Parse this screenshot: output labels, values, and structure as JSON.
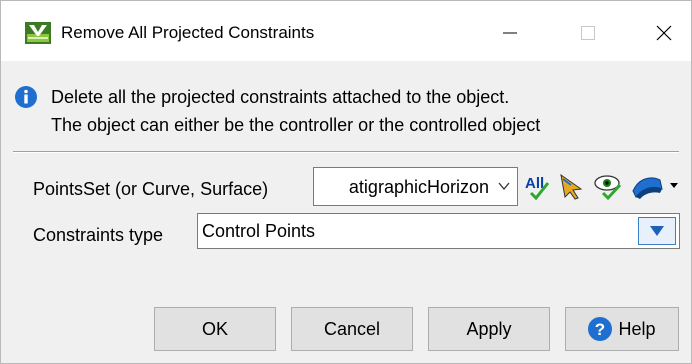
{
  "window": {
    "title": "Remove All Projected Constraints",
    "app_icon": "skua-gocad-app-icon",
    "controls": {
      "minimize": "minimize-icon",
      "maximize": "maximize-icon",
      "close": "close-icon"
    }
  },
  "info": {
    "icon": "info-icon",
    "line1": "Delete all the projected constraints attached to the object.",
    "line2": "The object can either be the controller or the controlled object"
  },
  "points_set": {
    "label": "PointsSet (or Curve, Surface)",
    "value": "atigraphicHorizon",
    "tools": {
      "all_label": "All",
      "pick_icon": "pick-cursor-icon",
      "eye_icon": "visible-eye-icon",
      "object_icon": "surface-object-icon"
    }
  },
  "constraints_type": {
    "label": "Constraints type",
    "value": "Control Points"
  },
  "buttons": {
    "ok": "OK",
    "cancel": "Cancel",
    "apply": "Apply",
    "help": "Help"
  },
  "colors": {
    "dialog_bg": "#f0f0f0",
    "accent_blue": "#1e6fd0",
    "check_green": "#2fa82f"
  }
}
